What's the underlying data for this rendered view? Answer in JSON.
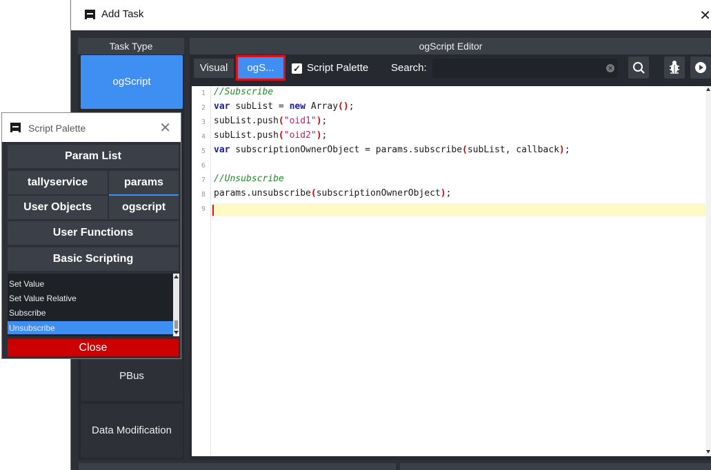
{
  "main_window": {
    "title": "Add Task",
    "task_type": {
      "header": "Task Type",
      "items": [
        "ogScript",
        "PBus",
        "Data Modification"
      ]
    },
    "editor": {
      "header": "ogScript Editor",
      "toolbar": {
        "visual_tab": "Visual",
        "ogscript_tab": "ogS...",
        "script_palette_label": "Script Palette",
        "script_palette_checked": true,
        "search_label": "Search:",
        "search_value": ""
      },
      "line_numbers": [
        "1",
        "2",
        "3",
        "4",
        "5",
        "6",
        "7",
        "8",
        "9"
      ],
      "code": {
        "l1_comment": "//Subscribe",
        "l2_kw": "var",
        "l2_a": " subList = ",
        "l2_kw2": "new",
        "l2_b": " Array",
        "l2_paren": "()",
        "l2_c": ";",
        "l3_a": "subList.push",
        "l3_open": "(",
        "l3_str": "\"oid1\"",
        "l3_close": ")",
        "l3_end": ";",
        "l4_a": "subList.push",
        "l4_open": "(",
        "l4_str": "\"oid2\"",
        "l4_close": ")",
        "l4_end": ";",
        "l5_kw": "var",
        "l5_a": " subscriptionOwnerObject = params.subscribe",
        "l5_open": "(",
        "l5_b": "subList, callback",
        "l5_close": ")",
        "l5_end": ";",
        "l7_comment": "//Unsubscribe",
        "l8_a": "params.unsubscribe",
        "l8_open": "(",
        "l8_b": "subscriptionOwnerObject",
        "l8_close": ")",
        "l8_end": ";"
      }
    }
  },
  "script_palette": {
    "title": "Script Palette",
    "buttons": {
      "param_list": "Param List",
      "tallyservice": "tallyservice",
      "params": "params",
      "user_objects": "User Objects",
      "ogscript": "ogscript",
      "user_functions": "User Functions",
      "basic_scripting": "Basic Scripting"
    },
    "list_items": [
      "Set Value",
      "Set Value Relative",
      "Subscribe",
      "Unsubscribe"
    ],
    "selected_item": "Unsubscribe",
    "close_label": "Close"
  },
  "colors": {
    "accent": "#3f8ef2",
    "panel_dark": "#2d3137",
    "panel_header": "#3b4048",
    "close_red": "#cc0000",
    "highlight_border": "#e0101a"
  }
}
